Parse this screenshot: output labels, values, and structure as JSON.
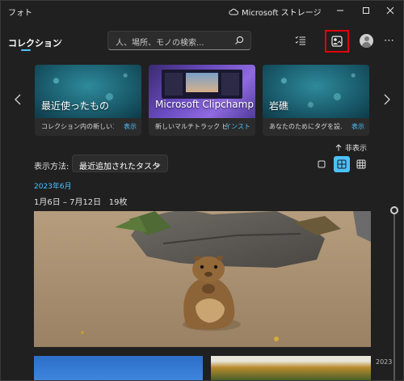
{
  "window": {
    "app_title": "フォト",
    "storage_label": "Microsoft ストレージ"
  },
  "toolbar": {
    "nav_tab": "コレクション",
    "more_label": "⋯",
    "search_placeholder": "人、場所、モノの検索...",
    "top_more": "⋯"
  },
  "cards": [
    {
      "image_title": "最近使ったもの",
      "footer_text": "コレクション内の新しいコ...",
      "footer_link": "表示"
    },
    {
      "image_title": "Microsoft Clipchamp",
      "footer_text": "新しいマルチトラック ビデ...",
      "footer_link": "インスト"
    },
    {
      "image_title": "岩礁",
      "footer_text": "あなたのためにタグを設...",
      "footer_link": "表示"
    }
  ],
  "view": {
    "hide_label": "非表示",
    "sort_label": "表示方法:",
    "sort_value": "最近追加されたタスク"
  },
  "gallery": {
    "month_header": "2023年6月",
    "date_range": "1月6日 – 7月12日",
    "item_count": "19枚",
    "timeline_year": "2023"
  },
  "colors": {
    "accent": "#4cc2ff",
    "highlight_border": "#e0000b",
    "background": "#202020"
  }
}
